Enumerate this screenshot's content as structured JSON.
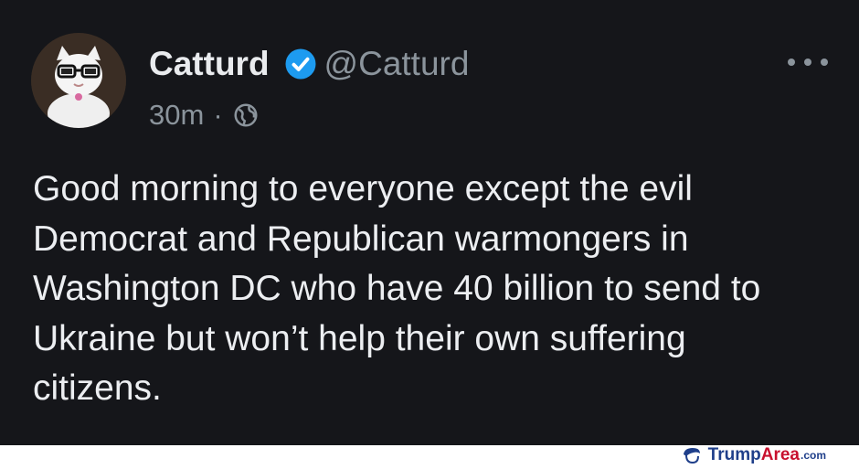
{
  "tweet": {
    "display_name": "Catturd",
    "handle": "@Catturd",
    "time": "30m",
    "separator": "·",
    "verified": true,
    "text": "Good morning to everyone except the evil\nDemocrat and Republican warmongers in\nWashington DC who have 40 billion to send to\nUkraine but won’t help their own suffering\ncitizens."
  },
  "icons": {
    "verified": "verified-badge-icon",
    "audience": "globe-icon",
    "more": "more-options-icon",
    "watermark": "trump-hair-logo-icon"
  },
  "watermark": {
    "brand_part1": "Trump",
    "brand_part2": "Area",
    "suffix": ".com"
  },
  "colors": {
    "background": "#15161a",
    "primary_text": "#eceef1",
    "secondary_text": "#8b949c",
    "verified_blue": "#1d9bf0",
    "watermark_blue": "#1f3f8a",
    "watermark_red": "#c8102e"
  }
}
